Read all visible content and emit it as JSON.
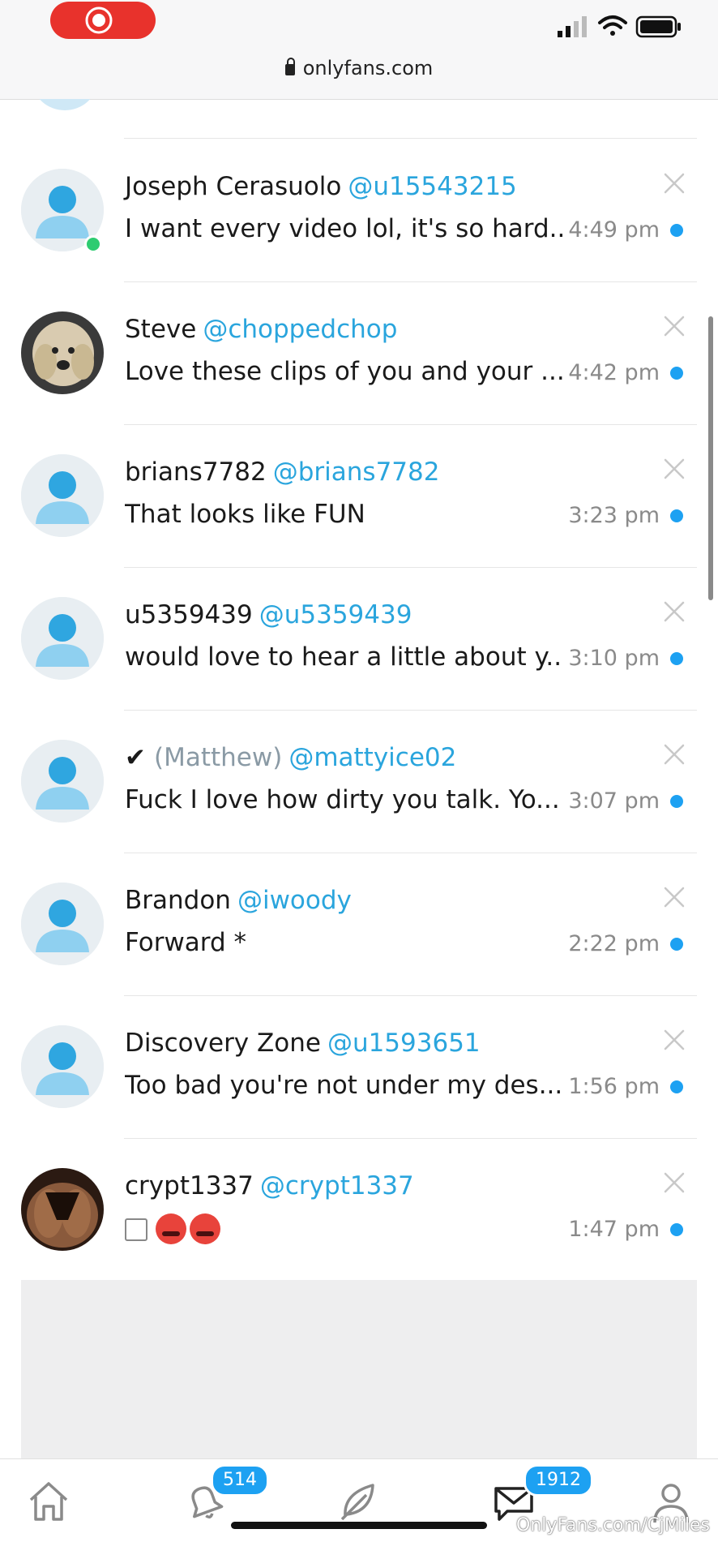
{
  "browser": {
    "url": "onlyfans.com"
  },
  "messages": [
    {
      "name": "Joseph Cerasuolo",
      "handle": "@u15543215",
      "preview": "I want every video lol, it's so hard...",
      "time": "4:49 pm",
      "online": true,
      "avatar": "default"
    },
    {
      "name": "Steve",
      "handle": "@choppedchop",
      "preview": "Love these clips of you and your ...",
      "time": "4:42 pm",
      "online": false,
      "avatar": "dog-photo"
    },
    {
      "name": "brians7782",
      "handle": "@brians7782",
      "preview": "That looks like FUN",
      "time": "3:23 pm",
      "online": false,
      "avatar": "default"
    },
    {
      "name": "u5359439",
      "handle": "@u5359439",
      "preview": "would love to hear a little about y...",
      "time": "3:10 pm",
      "online": false,
      "avatar": "default"
    },
    {
      "name": "(Matthew)",
      "handle": "@mattyice02",
      "preview": "Fuck I love how dirty you talk. Yo...",
      "time": "3:07 pm",
      "online": false,
      "avatar": "default",
      "prefix_icon": "check-icon"
    },
    {
      "name": "Brandon",
      "handle": "@iwoody",
      "preview": "Forward *",
      "time": "2:22 pm",
      "online": false,
      "avatar": "default"
    },
    {
      "name": "Discovery Zone",
      "handle": "@u1593651",
      "preview": "Too bad you're not under my des...",
      "time": "1:56 pm",
      "online": false,
      "avatar": "default"
    },
    {
      "name": "crypt1337",
      "handle": "@crypt1337",
      "preview": "",
      "time": "1:47 pm",
      "online": false,
      "avatar": "photo",
      "preview_icons": [
        "image-icon",
        "hot-face-emoji",
        "hot-face-emoji"
      ]
    }
  ],
  "nav": {
    "items": [
      "home-icon",
      "bell-icon",
      "feather-icon",
      "messages-icon",
      "profile-icon"
    ],
    "notifications_badge": "514",
    "messages_badge": "1912"
  },
  "watermark": "OnlyFans.com/CjMiles",
  "colors": {
    "accent": "#2aa5dd",
    "unread_dot": "#1da1f2",
    "online": "#2ecc71",
    "record": "#e8322c"
  }
}
